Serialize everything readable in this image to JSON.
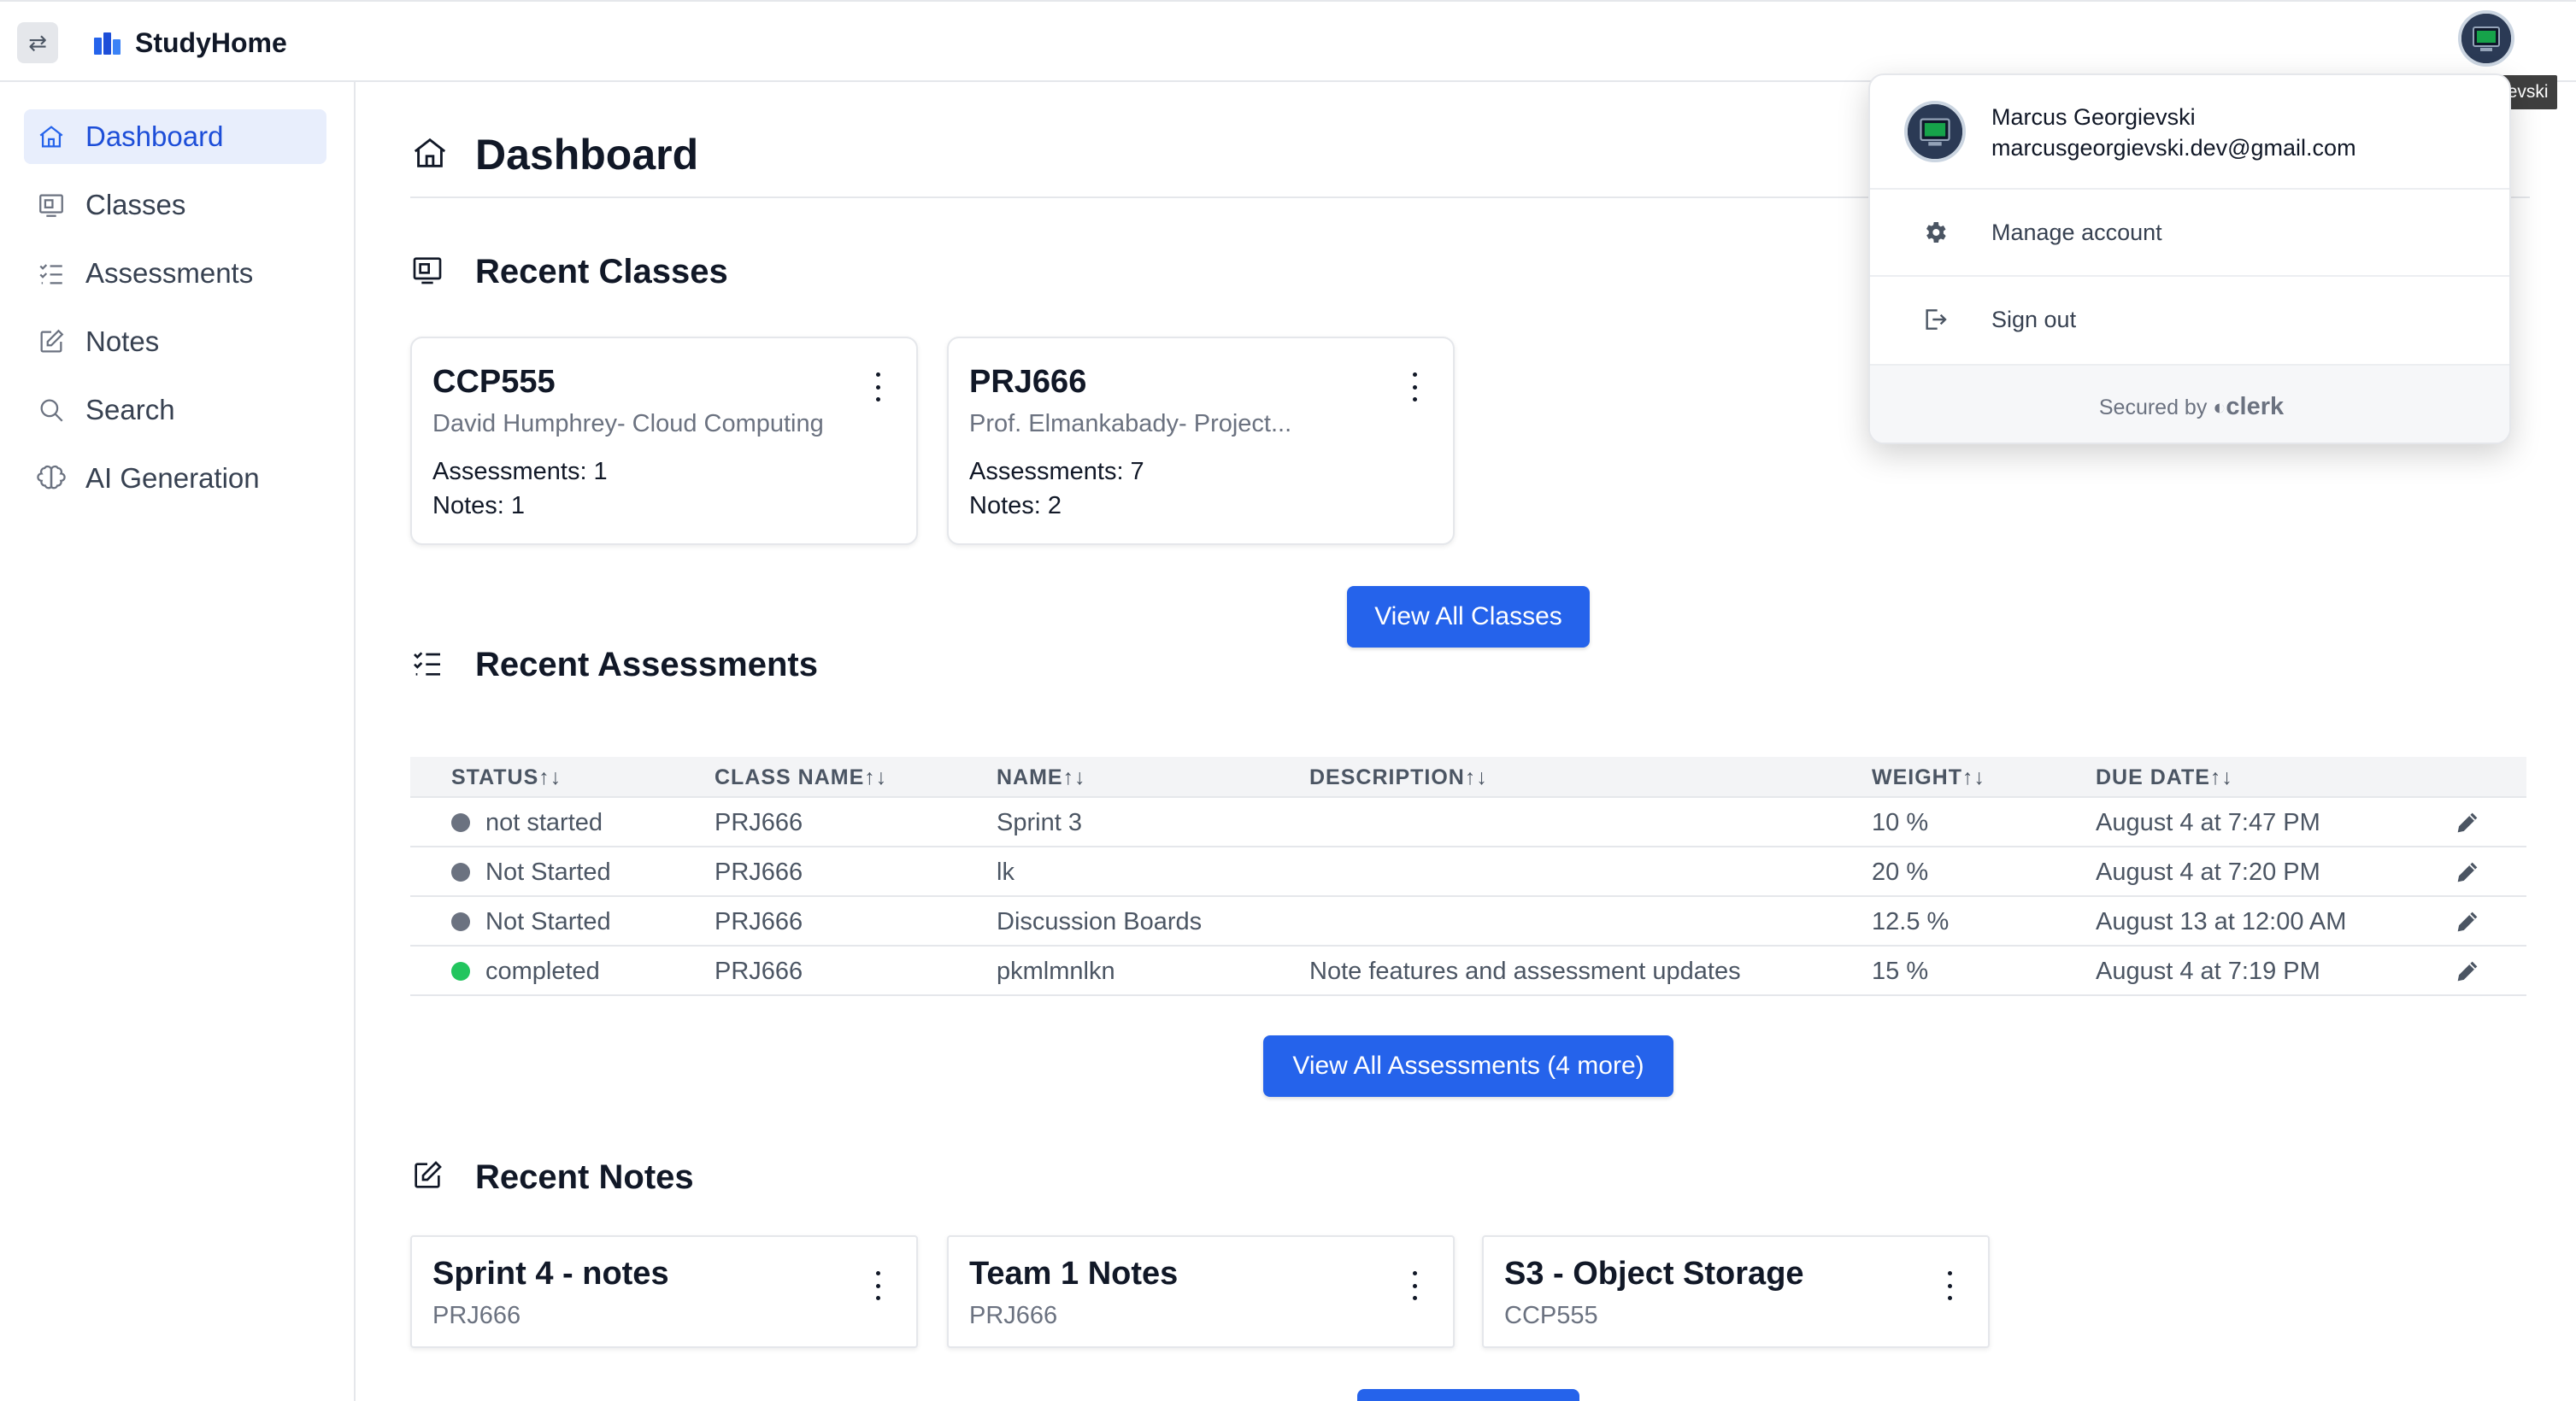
{
  "app": {
    "name": "StudyHome",
    "toggle_icon": "swap-arrows-icon"
  },
  "user": {
    "name": "Marcus Georgievski",
    "email": "marcusgeorgievski.dev@gmail.com",
    "tooltip": "Marcus Georgievski"
  },
  "sidebar": {
    "items": [
      {
        "label": "Dashboard",
        "icon": "home-icon",
        "active": true
      },
      {
        "label": "Classes",
        "icon": "presentation-icon"
      },
      {
        "label": "Assessments",
        "icon": "checklist-icon"
      },
      {
        "label": "Notes",
        "icon": "edit-note-icon"
      },
      {
        "label": "Search",
        "icon": "search-icon"
      },
      {
        "label": "AI Generation",
        "icon": "brain-icon"
      }
    ]
  },
  "page": {
    "title": "Dashboard"
  },
  "recent_classes": {
    "title": "Recent Classes",
    "cards": [
      {
        "code": "CCP555",
        "instructor": "David Humphrey- Cloud Computing",
        "assessments": "Assessments: 1",
        "notes": "Notes: 1"
      },
      {
        "code": "PRJ666",
        "instructor": "Prof. Elmankabady- Project...",
        "assessments": "Assessments: 7",
        "notes": "Notes: 2"
      }
    ],
    "view_all_label": "View All Classes"
  },
  "recent_assessments": {
    "title": "Recent Assessments",
    "columns": [
      "STATUS↑↓",
      "CLASS NAME↑↓",
      "NAME↑↓",
      "DESCRIPTION↑↓",
      "WEIGHT↑↓",
      "DUE DATE↑↓"
    ],
    "rows": [
      {
        "status": "not started",
        "status_color": "#6b7280",
        "class_name": "PRJ666",
        "name": "Sprint 3",
        "description": "",
        "weight": "10 %",
        "due": "August 4 at 7:47 PM"
      },
      {
        "status": "Not Started",
        "status_color": "#6b7280",
        "class_name": "PRJ666",
        "name": "lk",
        "description": "",
        "weight": "20 %",
        "due": "August 4 at 7:20 PM"
      },
      {
        "status": "Not Started",
        "status_color": "#6b7280",
        "class_name": "PRJ666",
        "name": "Discussion Boards",
        "description": "",
        "weight": "12.5 %",
        "due": "August 13 at 12:00 AM"
      },
      {
        "status": "completed",
        "status_color": "#22c55e",
        "class_name": "PRJ666",
        "name": "pkmlmnlkn",
        "description": "Note features and assessment updates",
        "weight": "15 %",
        "due": "August 4 at 7:19 PM"
      }
    ],
    "view_all_label": "View All Assessments (4 more)"
  },
  "recent_notes": {
    "title": "Recent Notes",
    "cards": [
      {
        "title": "Sprint 4 - notes",
        "class": "PRJ666"
      },
      {
        "title": "Team 1 Notes",
        "class": "PRJ666"
      },
      {
        "title": "S3 - Object Storage",
        "class": "CCP555"
      }
    ]
  },
  "account_menu": {
    "manage_label": "Manage account",
    "signout_label": "Sign out",
    "secured_by": "Secured by",
    "provider": "clerk"
  },
  "colors": {
    "primary": "#2563eb",
    "active_bg": "#e8eefc",
    "active_text": "#1d4ed8"
  }
}
